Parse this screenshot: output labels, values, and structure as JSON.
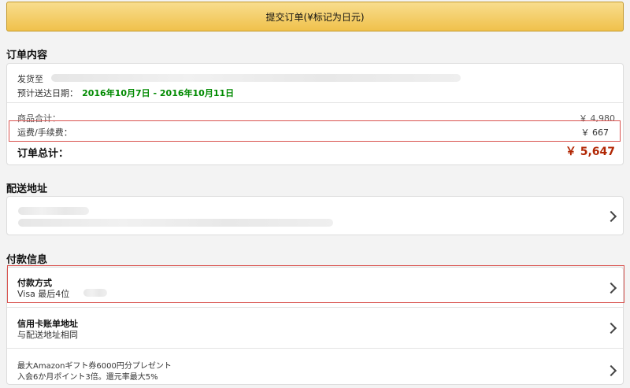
{
  "header": {
    "submit_label": "提交订单(¥标记为日元)"
  },
  "order": {
    "section_title": "订单内容",
    "ship_to_label": "发货至",
    "delivery_label": "预计送达日期：",
    "delivery_dates": "2016年10月7日 - 2016年10月11日",
    "subtotal_label": "商品合计：",
    "subtotal_value": "￥ 4,980",
    "shipping_label": "运费/手续费：",
    "shipping_value": "￥ 667",
    "total_label": "订单总计：",
    "total_value": "￥ 5,647"
  },
  "shipping_address": {
    "section_title": "配送地址"
  },
  "payment": {
    "section_title": "付款信息",
    "method_label": "付款方式",
    "method_value": "Visa 最后4位",
    "billing_label": "信用卡账单地址",
    "billing_value": "与配送地址相同",
    "promo_line1": "最大Amazonギフト券6000円分プレゼント",
    "promo_line2": "入会6か月ポイント3倍。還元率最大5%"
  },
  "colors": {
    "accent": "#f0c14b",
    "price": "#b12704",
    "delivery": "#008a00",
    "highlight": "#d9534f"
  }
}
